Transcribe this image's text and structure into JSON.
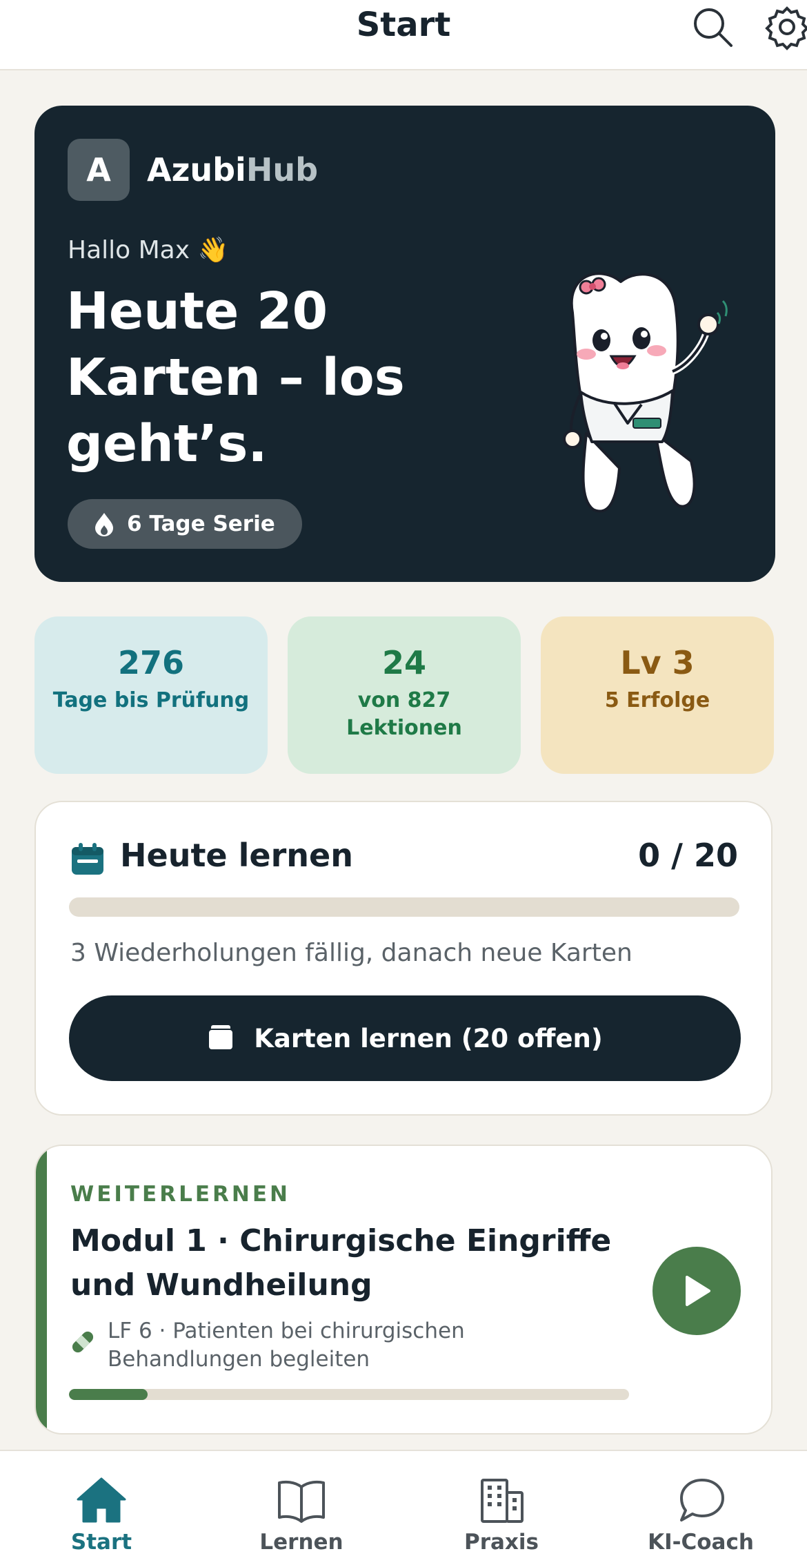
{
  "header": {
    "title": "Start",
    "icons": [
      "search-icon",
      "gear-icon"
    ]
  },
  "hero": {
    "logo_letter": "A",
    "brand_part1": "Azubi",
    "brand_part2": "Hub",
    "greeting": "Hallo Max 👋",
    "headline": "Heute 20 Karten – los geht’s.",
    "streak_label": "6 Tage Serie"
  },
  "stats": [
    {
      "value": "276",
      "label": "Tage bis Prüfung"
    },
    {
      "value": "24",
      "label": "von 827 Lektionen"
    },
    {
      "value": "Lv 3",
      "label": "5 Erfolge"
    }
  ],
  "today": {
    "title": "Heute lernen",
    "count": "0 / 20",
    "progress": 0,
    "subtitle": "3 Wiederholungen fällig, danach neue Karten",
    "button_label": "Karten lernen (20 offen)"
  },
  "continue": {
    "kicker": "WEITERLERNEN",
    "title": "Modul 1 · Chirurgische Eingriffe und Wundheilung",
    "field": "LF 6 · Patienten bei chirurgischen Behandlungen begleiten",
    "progress": 0.14
  },
  "tabs": [
    {
      "label": "Start",
      "icon": "home-icon",
      "active": true
    },
    {
      "label": "Lernen",
      "icon": "book-icon",
      "active": false
    },
    {
      "label": "Praxis",
      "icon": "building-icon",
      "active": false
    },
    {
      "label": "KI-Coach",
      "icon": "chat-bubble-icon",
      "active": false
    }
  ],
  "colors": {
    "hero_bg": "#16252f",
    "accent_green": "#4a7d4b",
    "accent_teal": "#1b7280",
    "stat1_bg": "#d7ebec",
    "stat2_bg": "#d6ebdb",
    "stat3_bg": "#f4e4bf"
  }
}
